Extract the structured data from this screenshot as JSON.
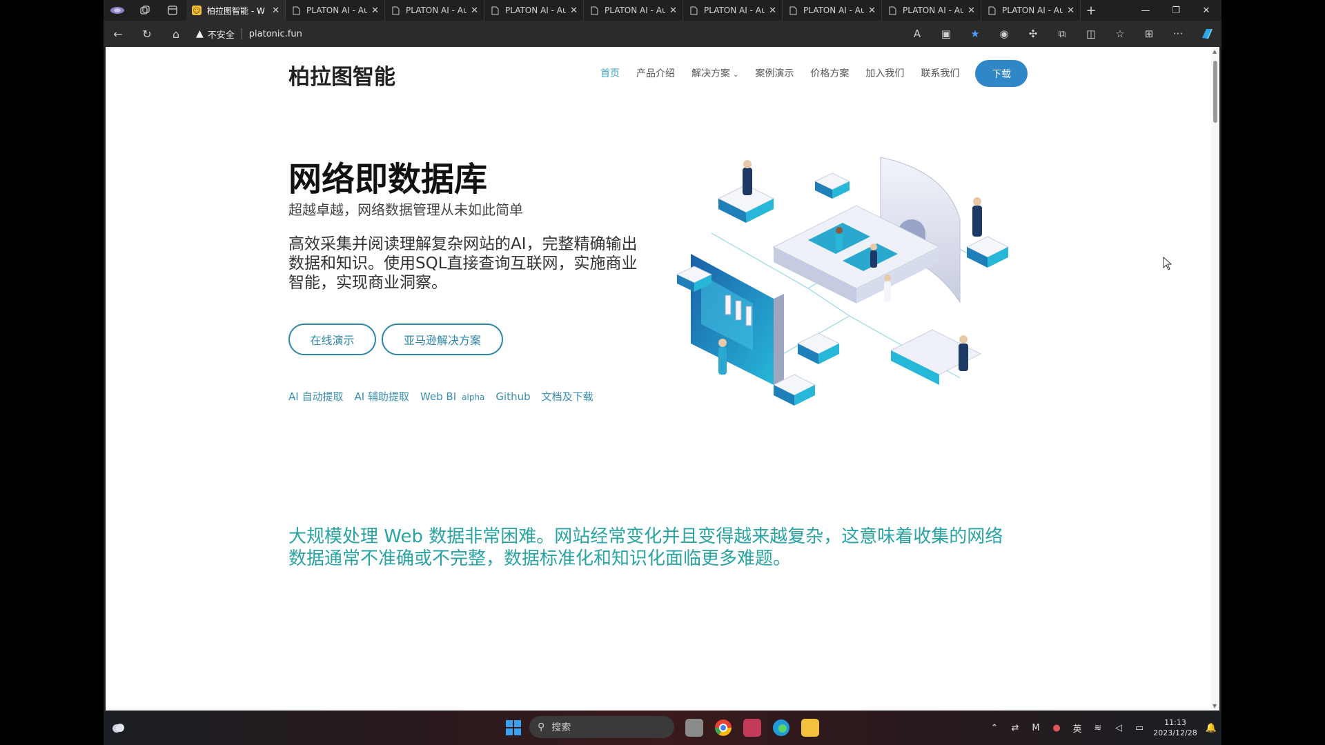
{
  "browser": {
    "tabs": [
      {
        "title": "柏拉图智能 - W",
        "active": true
      },
      {
        "title": "PLATON AI - Au",
        "active": false
      },
      {
        "title": "PLATON AI - Au",
        "active": false
      },
      {
        "title": "PLATON AI - Au",
        "active": false
      },
      {
        "title": "PLATON AI - Au",
        "active": false
      },
      {
        "title": "PLATON AI - Au",
        "active": false
      },
      {
        "title": "PLATON AI - Au",
        "active": false
      },
      {
        "title": "PLATON AI - Au",
        "active": false
      },
      {
        "title": "PLATON AI - Au",
        "active": false
      }
    ],
    "insecure_label": "不安全",
    "url": "platonic.fun"
  },
  "site": {
    "logo": "柏拉图智能",
    "nav": [
      "首页",
      "产品介绍",
      "解决方案",
      "案例演示",
      "价格方案",
      "加入我们",
      "联系我们"
    ],
    "download": "下载",
    "hero_title": "网络即数据库",
    "hero_subtitle": "超越卓越，网络数据管理从未如此简单",
    "hero_desc": "高效采集并阅读理解复杂网站的AI，完整精确输出数据和知识。使用SQL直接查询互联网，实施商业智能，实现商业洞察。",
    "btn_demo": "在线演示",
    "btn_amazon": "亚马逊解决方案",
    "links": [
      "AI 自动提取",
      "AI 辅助提取",
      "Web BI",
      "Github",
      "文档及下载"
    ],
    "alpha": "alpha",
    "statement": "大规模处理 Web 数据非常困难。网站经常变化并且变得越来越复杂，这意味着收集的网络数据通常不准确或不完整，数据标准化和知识化面临更多难题。"
  },
  "taskbar": {
    "search_placeholder": "搜索",
    "ime": "英",
    "time": "11:13",
    "date": "2023/12/28"
  },
  "colors": {
    "accent": "#2f87c8",
    "link": "#3a8fb3",
    "statement": "#2aa3a3"
  }
}
